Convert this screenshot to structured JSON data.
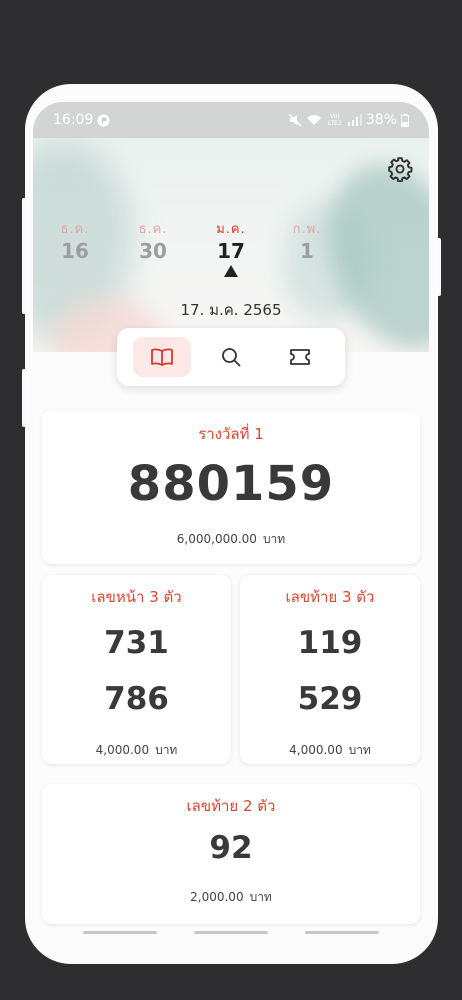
{
  "status_bar": {
    "time": "16:09",
    "network": "Vo) LTE2",
    "battery": "38%"
  },
  "months": [
    {
      "month": "ธ.ค.",
      "day": "16",
      "active": false
    },
    {
      "month": "ธ.ค.",
      "day": "30",
      "active": false
    },
    {
      "month": "ม.ค.",
      "day": "17",
      "active": true
    },
    {
      "month": "ก.พ.",
      "day": "1",
      "active": false
    }
  ],
  "selected_date": "17. ม.ค. 2565",
  "tabs": [
    {
      "icon": "book-icon",
      "active": true
    },
    {
      "icon": "search-icon",
      "active": false
    },
    {
      "icon": "ticket-icon",
      "active": false
    }
  ],
  "first_prize": {
    "title": "รางวัลที่ 1",
    "number": "880159",
    "amount": "6,000,000.00",
    "unit": "บาท"
  },
  "front_three": {
    "title": "เลขหน้า 3 ตัว",
    "numbers": [
      "731",
      "786"
    ],
    "amount": "4,000.00",
    "unit": "บาท"
  },
  "last_three": {
    "title": "เลขท้าย 3 ตัว",
    "numbers": [
      "119",
      "529"
    ],
    "amount": "4,000.00",
    "unit": "บาท"
  },
  "last_two": {
    "title": "เลขท้าย 2 ตัว",
    "number": "92",
    "amount": "2,000.00",
    "unit": "บาท"
  },
  "colors": {
    "accent": "#d9382d",
    "tab_active_bg": "#fde8e8",
    "frame": "#2e2d30"
  }
}
